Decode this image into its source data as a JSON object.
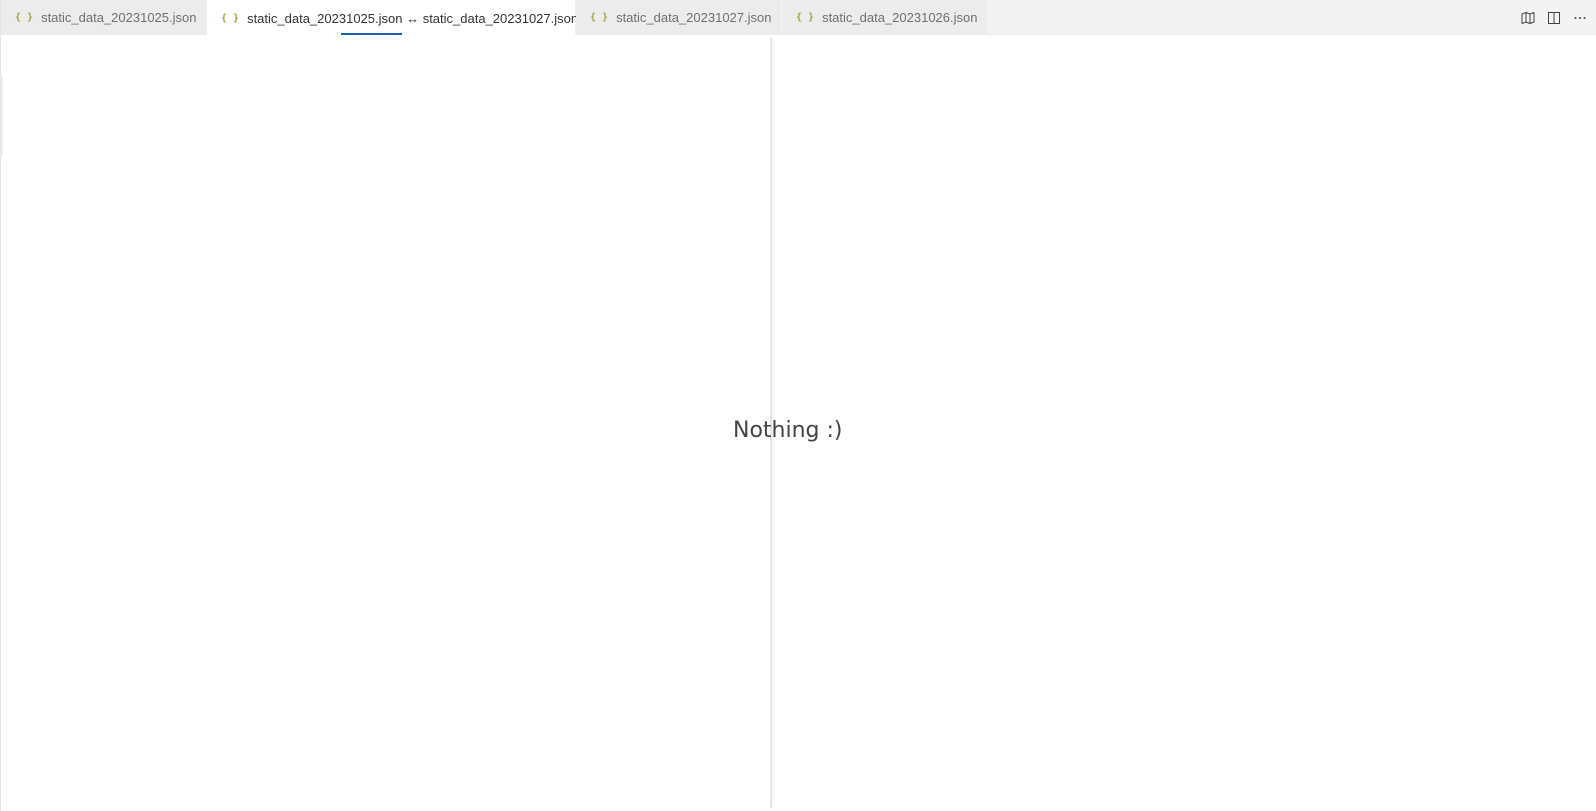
{
  "tabs": [
    {
      "label": "static_data_20231025.json",
      "icon": "json-icon",
      "active": false
    },
    {
      "label": "static_data_20231025.json ↔ static_data_20231027.json",
      "icon": "json-icon",
      "active": true
    },
    {
      "label": "static_data_20231027.json",
      "icon": "json-icon",
      "active": false
    },
    {
      "label": "static_data_20231026.json",
      "icon": "json-icon",
      "active": false
    }
  ],
  "tab_icon_glyph": "{ }",
  "actions": [
    "open-map-icon",
    "split-editor-icon",
    "more-actions-icon"
  ],
  "editor": {
    "empty_message": "Nothing :)"
  },
  "colors": {
    "accent_underline": "#1e5cb3",
    "json_icon": "#a3a340"
  }
}
